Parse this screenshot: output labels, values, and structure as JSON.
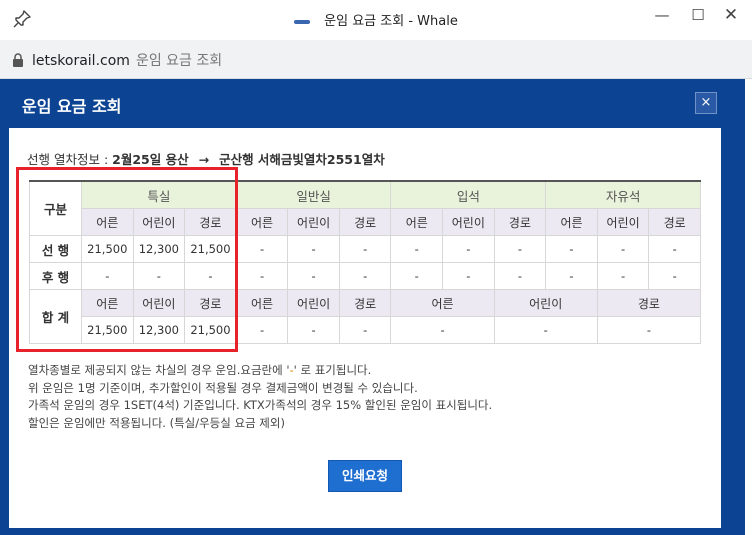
{
  "window": {
    "title": "운임 요금 조회 - Whale",
    "minimize": "—",
    "maximize": "☐",
    "close": "✕"
  },
  "address": {
    "domain": "letskorail.com",
    "page_title": "운임 요금 조회"
  },
  "popup": {
    "title": "운임 요금 조회",
    "close": "×"
  },
  "train_info": {
    "label": "선행 열차정보 :",
    "date_route": "2월25일 용산",
    "arrow": "→",
    "destination": "군산행 서해금빛열차2551열차"
  },
  "table": {
    "category_header": "구분",
    "classes": [
      "특실",
      "일반실",
      "입석",
      "자유석"
    ],
    "passenger_types": [
      "어른",
      "어린이",
      "경로"
    ],
    "rows": [
      {
        "label": "선 행",
        "values": [
          "21,500",
          "12,300",
          "21,500",
          "-",
          "-",
          "-",
          "-",
          "-",
          "-",
          "-",
          "-",
          "-"
        ]
      },
      {
        "label": "후 행",
        "values": [
          "-",
          "-",
          "-",
          "-",
          "-",
          "-",
          "-",
          "-",
          "-",
          "-",
          "-",
          "-"
        ]
      }
    ],
    "total": {
      "label": "합 계",
      "headers": [
        "어른",
        "어린이",
        "경로",
        "어른",
        "어린이",
        "경로",
        "어른",
        "어린이",
        "경로"
      ],
      "values": [
        "21,500",
        "12,300",
        "21,500",
        "-",
        "-",
        "-",
        "-",
        "-",
        "-"
      ]
    }
  },
  "notes": {
    "line1_before": "열차종별로 제공되지 않는 차실의 경우 운임.요금란에 '",
    "line1_dash": "-",
    "line1_after": "' 로 표기됩니다.",
    "line2": "위 운임은 1명 기준이며, 추가할인이 적용될 경우 결제금액이 변경될 수 있습니다.",
    "line3": "가족석 운임의 경우 1SET(4석) 기준입니다. KTX가족석의 경우 15% 할인된 운임이 표시됩니다.",
    "line4": "할인은 운임에만 적용됩니다. (특실/우등실 요금 제외)"
  },
  "print_button": "인쇄요청"
}
